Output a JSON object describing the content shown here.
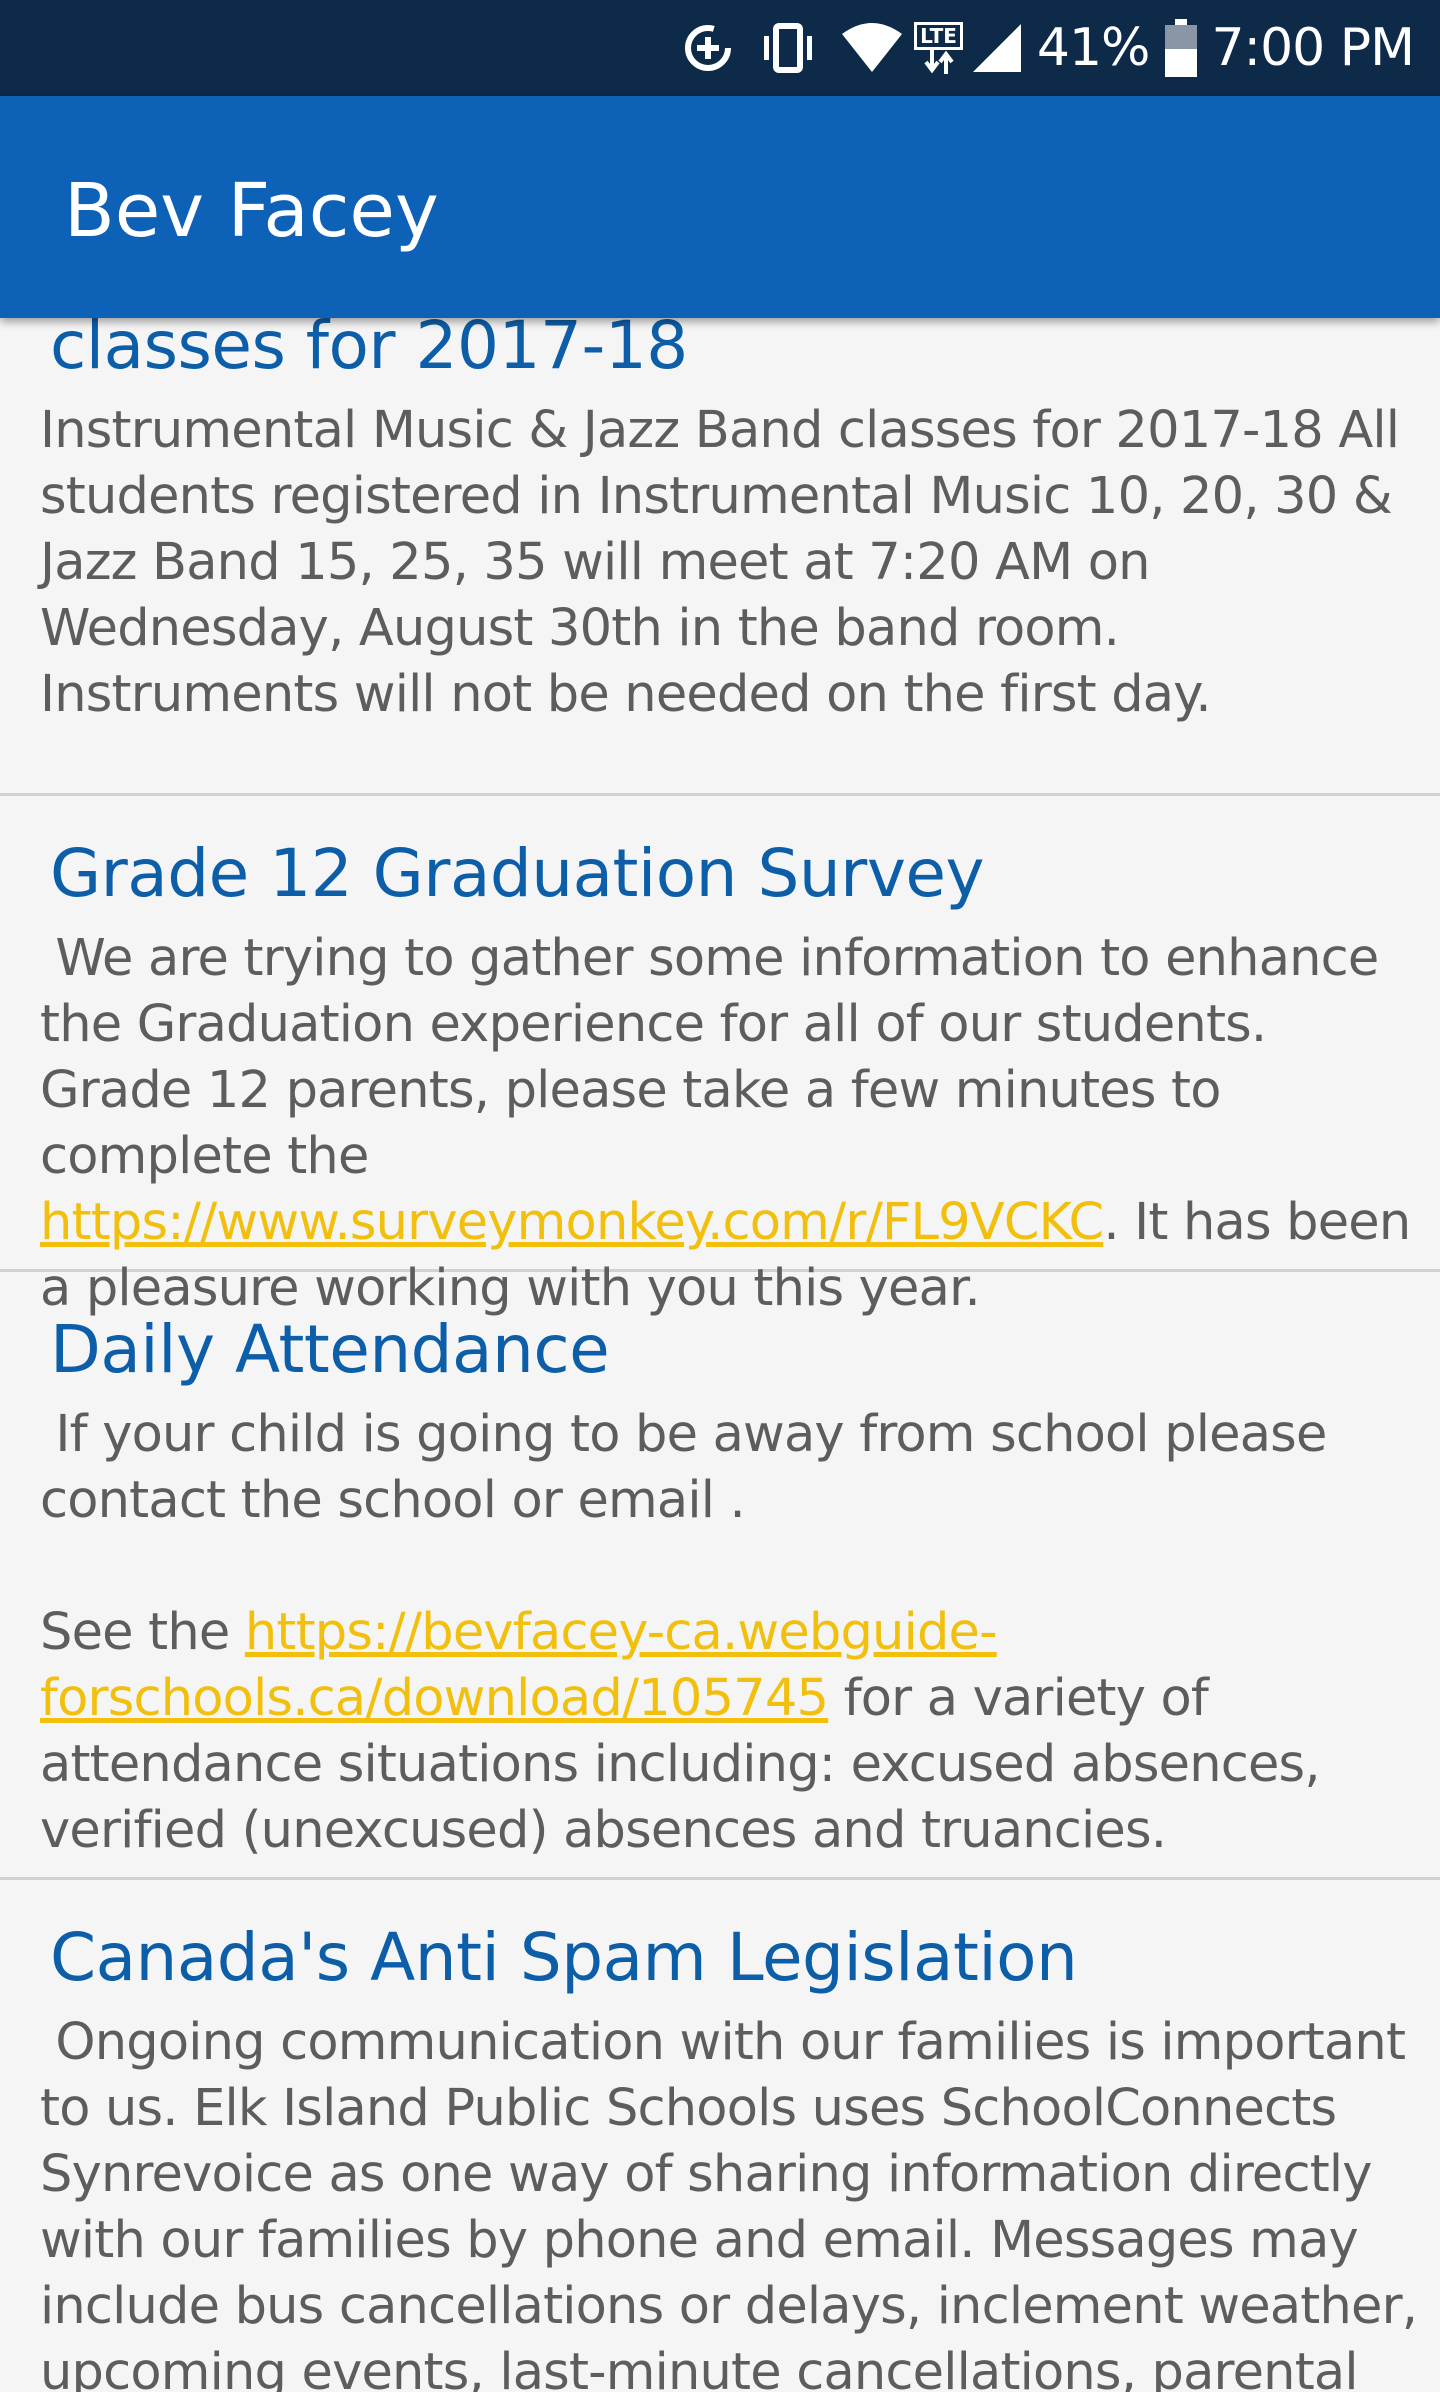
{
  "status_bar": {
    "battery_percent": "41%",
    "time": "7:00 PM",
    "network_label": "LTE",
    "icons": [
      "data-saver-icon",
      "vibrate-icon",
      "wifi-icon",
      "lte-icon",
      "cell-signal-icon",
      "battery-icon"
    ]
  },
  "app_bar": {
    "title": "Bev Facey"
  },
  "news": [
    {
      "title": "classes for 2017-18",
      "body": "Instrumental Music & Jazz Band classes for 2017-18 All students registered in Instrumental Music 10, 20, 30 & Jazz Band 15, 25, 35 will meet at 7:20 AM on Wednesday, August 30th in the band room. Instruments will not be needed on the first day."
    },
    {
      "title": "Grade 12 Graduation Survey",
      "body_before": " We are trying to gather some information to enhance the Graduation experience for all of our students. Grade 12 parents, please take a few minutes to complete the ",
      "link": "https://www.surveymonkey.com/r/FL9VCKC",
      "body_after": ". It has been a pleasure working with you this year."
    },
    {
      "title": "Daily Attendance",
      "body_before": " If your child is going to be away from school please contact the school or email .\n\nSee the ",
      "link": "https://bevfacey-ca.webguide-forschools.ca/download/105745",
      "body_after": " for a variety of attendance situations including: excused absences, verified (unexcused) absences and truancies."
    },
    {
      "title": "Canada's Anti Spam Legislation",
      "body": " Ongoing communication with our families is important to us. Elk Island Public Schools uses SchoolConnects Synrevoice as one way of sharing information directly with our families by phone and email. Messages may include bus cancellations or delays, inclement weather, upcoming events, last-minute cancellations, parental"
    }
  ],
  "colors": {
    "status_bar": "#0d2a49",
    "app_bar": "#0d61b7",
    "title_text": "#0d5ea8",
    "body_text": "#5d5d5d",
    "link": "#f2bf0c",
    "divider": "#d2d2d2",
    "background": "#f5f5f5"
  }
}
